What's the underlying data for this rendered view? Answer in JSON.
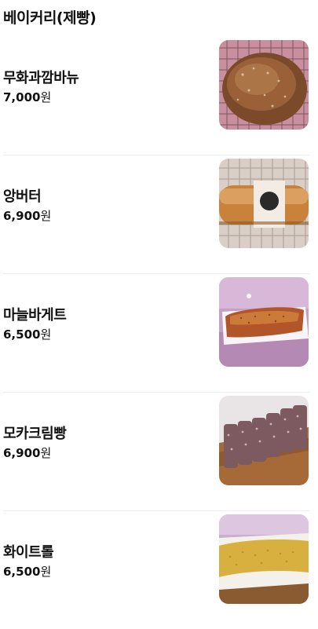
{
  "section": {
    "title": "베이커리(제빵)"
  },
  "items": [
    {
      "name": "무화과깜바뉴",
      "price": "7,000",
      "unit": "원",
      "image": "fig-campagne-photo"
    },
    {
      "name": "앙버터",
      "price": "6,900",
      "unit": "원",
      "image": "anbutter-photo"
    },
    {
      "name": "마늘바게트",
      "price": "6,500",
      "unit": "원",
      "image": "garlic-baguette-photo"
    },
    {
      "name": "모카크림빵",
      "price": "6,900",
      "unit": "원",
      "image": "mocha-cream-bread-photo"
    },
    {
      "name": "화이트롤",
      "price": "6,500",
      "unit": "원",
      "image": "white-roll-photo"
    }
  ]
}
